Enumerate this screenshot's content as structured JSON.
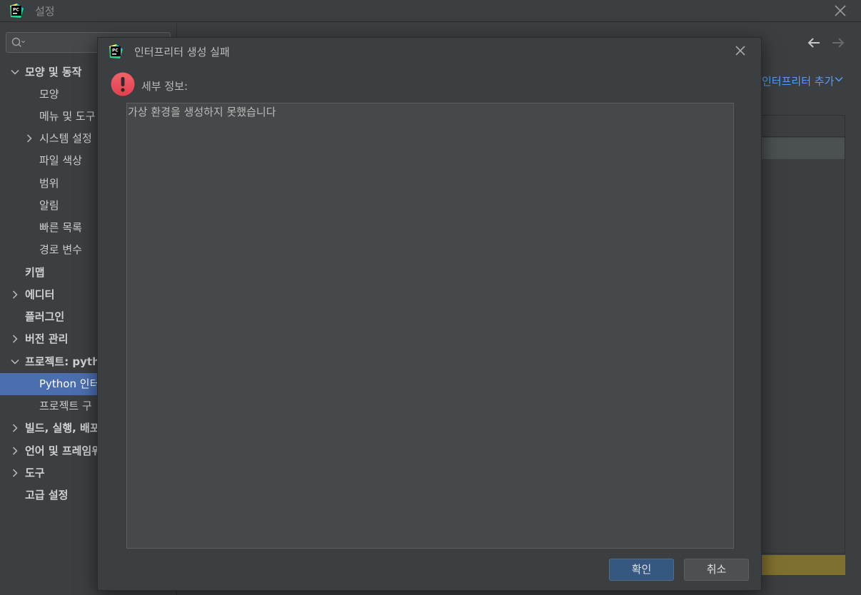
{
  "window": {
    "title": "설정"
  },
  "search": {
    "placeholder": ""
  },
  "sidebar": {
    "items": [
      {
        "label": "모양 및 동작"
      },
      {
        "label": "모양"
      },
      {
        "label": "메뉴 및 도구"
      },
      {
        "label": "시스템 설정"
      },
      {
        "label": "파일 색상"
      },
      {
        "label": "범위"
      },
      {
        "label": "알림"
      },
      {
        "label": "빠른 목록"
      },
      {
        "label": "경로 변수"
      },
      {
        "label": "키맵"
      },
      {
        "label": "에디터"
      },
      {
        "label": "플러그인"
      },
      {
        "label": "버전 관리"
      },
      {
        "label": "프로젝트: pytho"
      },
      {
        "label": "Python 인터"
      },
      {
        "label": "프로젝트 구"
      },
      {
        "label": "빌드, 실행, 배포"
      },
      {
        "label": "언어 및 프레임워"
      },
      {
        "label": "도구"
      },
      {
        "label": "고급 설정"
      }
    ]
  },
  "main": {
    "add_interpreter_label": "인터프리터 추가"
  },
  "dialog": {
    "title": "인터프리터 생성 실패",
    "details_label": "세부 정보:",
    "details_text": "가상 환경을 생성하지 못했습니다",
    "ok_label": "확인",
    "cancel_label": "취소"
  },
  "colors": {
    "background": "#3c3f41",
    "selection": "#4b6eaf",
    "link": "#589df6",
    "primary_button": "#365880",
    "error": "#e8555f"
  },
  "icons": [
    "pycharm-logo",
    "close-icon",
    "search-icon",
    "chevron-down-icon",
    "chevron-right-icon",
    "arrow-left-icon",
    "arrow-right-icon",
    "error-icon"
  ]
}
